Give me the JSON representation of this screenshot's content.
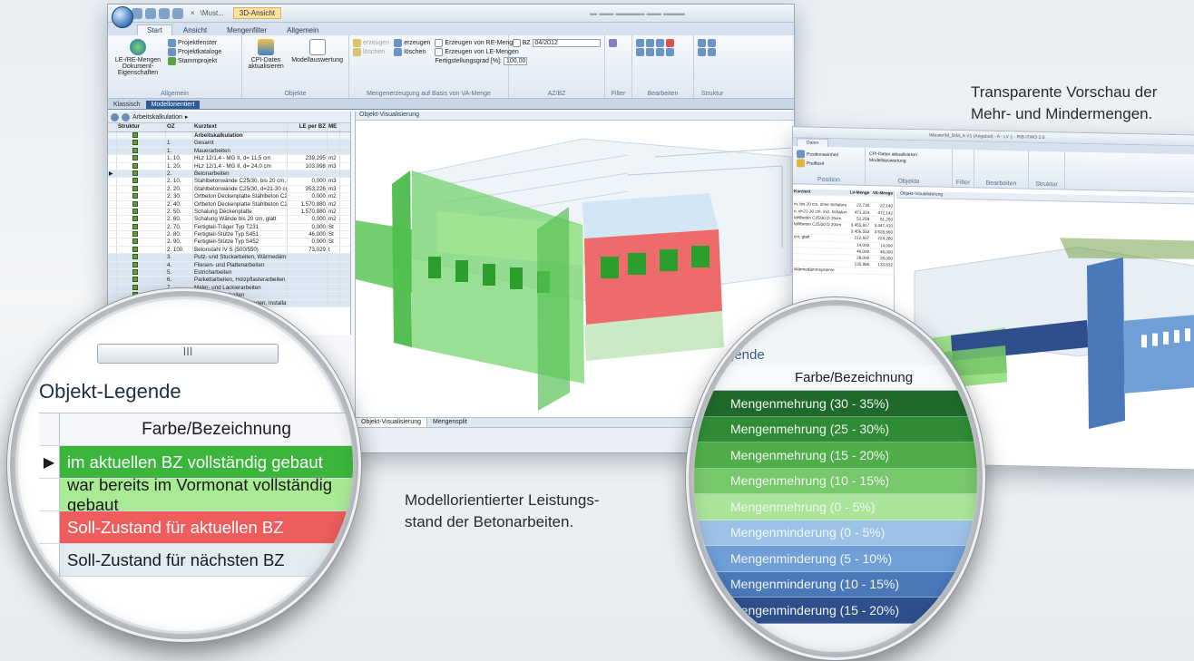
{
  "window1": {
    "context_tab": "3D-Ansicht",
    "doc_label": "\\Must...",
    "tabs": [
      "Start",
      "Ansicht",
      "Mengenfilter",
      "Allgemein"
    ],
    "ribbon": {
      "allgemein": {
        "big": "LE-/RE-Mengen Dokument-Eigenschaften",
        "items": [
          "Projektfenster",
          "Projektkataloge",
          "Stammprojekt"
        ],
        "group": "Allgemein"
      },
      "objekte": {
        "items": [
          "CPI-Daten aktualisieren",
          "Modellauswertung"
        ],
        "group": "Objekte"
      },
      "mengen": {
        "items": [
          "erzeugen",
          "löschen",
          "erzeugen",
          "löschen",
          "Erzeugen von RE-Mengen",
          "Erzeugen von LE-Mengen"
        ],
        "fertig_label": "Fertigstellungsgrad [%]:",
        "fertig_value": "100,00",
        "group": "Mengenerzeugung auf Basis von VA-Menge"
      },
      "azbz": {
        "bz_label": "BZ",
        "bz_value": "04/2012",
        "group": "AZ/BZ"
      },
      "filter": {
        "group": "Filter"
      },
      "bearbeiten": {
        "group": "Bearbeiten"
      },
      "struktur": {
        "group": "Struktur"
      }
    },
    "view_tabs": [
      "Klassisch",
      "Modellorientiert"
    ],
    "tree_toolbar_label": "Arbeitskalkulation",
    "grid": {
      "headers": [
        "Struktur",
        "OZ",
        "Kurztext",
        "LE per BZ",
        "ME"
      ],
      "rows": [
        {
          "oz": "",
          "text": "Arbeitskalkulation",
          "le": "",
          "me": "",
          "cls": "sec"
        },
        {
          "oz": "1",
          "text": "Gesamt",
          "le": "",
          "me": "",
          "cls": "hl"
        },
        {
          "oz": "1.",
          "text": "Mauerarbeiten",
          "le": "",
          "me": "",
          "cls": "hl"
        },
        {
          "oz": "1. 10.",
          "text": "HLz 12/1,4 - MG II, d= 11,5 cm",
          "le": "239,295",
          "me": "m2",
          "cls": ""
        },
        {
          "oz": "1. 20.",
          "text": "HLz 12/1,4 - MG II, d= 24,0 cm",
          "le": "103,098",
          "me": "m3",
          "cls": ""
        },
        {
          "oz": "2.",
          "text": "Betonarbeiten",
          "le": "",
          "me": "",
          "cls": "hl"
        },
        {
          "oz": "2. 10.",
          "text": "Stahlbetonwände C25/30, bis 20 cm, ohn",
          "le": "0,000",
          "me": "m3",
          "cls": ""
        },
        {
          "oz": "2. 20.",
          "text": "Stahlbetonwände C25/30, d=21-30 cm, in",
          "le": "353,226",
          "me": "m3",
          "cls": ""
        },
        {
          "oz": "2. 30.",
          "text": "Ortbeton Deckenplatte Stahlbeton C25/3(",
          "le": "0,000",
          "me": "m2",
          "cls": ""
        },
        {
          "oz": "2. 40.",
          "text": "Ortbeton Deckenplatte Stahlbeton C25/3(",
          "le": "1.570,980",
          "me": "m2",
          "cls": ""
        },
        {
          "oz": "2. 50.",
          "text": "Schalung Deckenplatte",
          "le": "1.570,980",
          "me": "m2",
          "cls": ""
        },
        {
          "oz": "2. 60.",
          "text": "Schalung Wände bis 20 cm, glatt",
          "le": "0,000",
          "me": "m2",
          "cls": ""
        },
        {
          "oz": "2. 70.",
          "text": "Fertigteil-Träger Typ T231",
          "le": "0,000",
          "me": "St",
          "cls": ""
        },
        {
          "oz": "2. 80.",
          "text": "Fertigteil-Stütze Typ S451",
          "le": "46,000",
          "me": "St",
          "cls": ""
        },
        {
          "oz": "2. 90.",
          "text": "Fertigteil-Stütze Typ S452",
          "le": "0,000",
          "me": "St",
          "cls": ""
        },
        {
          "oz": "2. 100.",
          "text": "Betonstahl IV S (500/550)",
          "le": "73,029",
          "me": "t",
          "cls": ""
        },
        {
          "oz": "3.",
          "text": "Putz- und Stuckarbeiten, Wärmedämmsyst",
          "le": "",
          "me": "",
          "cls": "hl"
        },
        {
          "oz": "4.",
          "text": "Fliesen- und Plattenarbeiten",
          "le": "",
          "me": "",
          "cls": "hl"
        },
        {
          "oz": "5.",
          "text": "Estricharbeiten",
          "le": "",
          "me": "",
          "cls": "hl"
        },
        {
          "oz": "6.",
          "text": "Parkettarbeiten, Holzpflasterarbeiten",
          "le": "",
          "me": "",
          "cls": "hl"
        },
        {
          "oz": "7.",
          "text": "Maler- und Lackierarbeiten",
          "le": "",
          "me": "",
          "cls": "hl"
        },
        {
          "oz": "8.",
          "text": "Bodenbelagarbeiten",
          "le": "",
          "me": "",
          "cls": "hl"
        },
        {
          "oz": "9.",
          "text": "Raumlufttechnische Anlagen, Installationsarbeiten; Leit",
          "le": "",
          "me": "",
          "cls": "hl"
        }
      ]
    },
    "viewport_title": "Objekt-Visualisierung",
    "viewport_tabs": [
      "Objekt-Visualisierung",
      "Mengensplit"
    ]
  },
  "window2": {
    "title": "\\Muster\\M_BIM_A V1 (Angebot) - A - LV 1 - RIB iTWO 2.0",
    "tab": "Daten",
    "ribbon_items": [
      "Positionseinheit",
      "Preiflexit",
      "CPI-Daten aktualisieren",
      "Modellauswertung"
    ],
    "ribbon_groups": [
      "Position",
      "Objekte",
      "Filter",
      "Bearbeiten",
      "Struktur"
    ],
    "viewport_title": "Objekt-Visualisierung",
    "headers": [
      "Kurztext",
      "LV-Menge",
      "VA-Menge"
    ],
    "rows": [
      [
        "",
        "",
        ""
      ],
      [
        "m, bis 20 cm, ohne Schalung",
        "22,730",
        "22,140"
      ],
      [
        "n, d=21-30 cm, incl. Schalung",
        "471,324",
        "472,142"
      ],
      [
        "tahlbeton C25/30 D 15cm",
        "51,259",
        "51,250"
      ],
      [
        "tahlbeton C25/30 D 20cm",
        "3.455,917",
        "3.447,410"
      ],
      [
        "",
        "3.456,553",
        "3.528,660"
      ],
      [
        "cm, glatt",
        "212,607",
        "224,280"
      ],
      [
        "",
        "14,000",
        "14,000"
      ],
      [
        "",
        "46,000",
        "46,000"
      ],
      [
        "",
        "28,000",
        "28,000"
      ],
      [
        "",
        "135,986",
        "133,632"
      ],
      [
        "Wärmedämmsysteme",
        "",
        ""
      ]
    ]
  },
  "captions": {
    "right_line1": "Transparente Vorschau der",
    "right_line2": "Mehr- und Mindermengen.",
    "middle_line1": "Modellorientierter Leistungs-",
    "middle_line2": "stand der Betonarbeiten."
  },
  "legend1": {
    "title": "Objekt-Legende",
    "header": "Farbe/Bezeichnung",
    "rows": [
      {
        "label": "im aktuellen BZ vollständig gebaut",
        "color": "#3cb53c",
        "text_color": "#ffffff",
        "pointer": "▶"
      },
      {
        "label": "war bereits im Vormonat vollständig gebaut",
        "color": "#a9ea95",
        "text_color": "#1a1a1a",
        "pointer": ""
      },
      {
        "label": "Soll-Zustand für aktuellen BZ",
        "color": "#ee5c5c",
        "text_color": "#ffffff",
        "pointer": ""
      },
      {
        "label": "Soll-Zustand für nächsten BZ",
        "color": "#e3ebf2",
        "text_color": "#1a1a1a",
        "pointer": ""
      }
    ]
  },
  "legend2": {
    "title": "gende",
    "header": "Farbe/Bezeichnung",
    "rows": [
      {
        "label": "Mengenmehrung (30 - 35%)",
        "color": "#1f6a2a"
      },
      {
        "label": "Mengenmehrung (25 - 30%)",
        "color": "#2f8b36"
      },
      {
        "label": "Mengenmehrung (15 - 20%)",
        "color": "#4fae4a"
      },
      {
        "label": "Mengenmehrung (10 - 15%)",
        "color": "#77c86a"
      },
      {
        "label": "Mengenmehrung (0 - 5%)",
        "color": "#a9e49a"
      },
      {
        "label": "Mengenminderung (0 - 5%)",
        "color": "#9cc2e8"
      },
      {
        "label": "Mengenminderung (5 - 10%)",
        "color": "#6f9fd6"
      },
      {
        "label": "Mengenminderung (10 - 15%)",
        "color": "#4a78b9"
      },
      {
        "label": "Mengenminderung (15 - 20%)",
        "color": "#2e4f8c"
      }
    ]
  }
}
